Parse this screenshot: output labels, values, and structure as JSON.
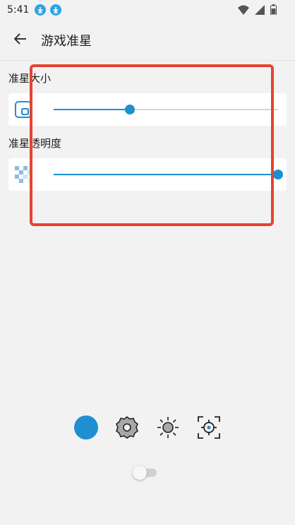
{
  "status_bar": {
    "time": "5:41",
    "icons": [
      "download-icon",
      "download-icon",
      "wifi-icon",
      "signal-icon",
      "battery-icon"
    ]
  },
  "app_bar": {
    "back_icon": "arrow-left-icon",
    "title": "游戏准星"
  },
  "settings": {
    "size": {
      "label": "准星大小",
      "icon": "crosshair-size-icon",
      "value_fraction": 0.34
    },
    "opacity": {
      "label": "准星透明度",
      "icon": "checkerboard-icon",
      "value_fraction": 1.0
    }
  },
  "toolbar": {
    "items": [
      "color-dot-icon",
      "settings-gear-icon",
      "brightness-icon",
      "crosshair-target-icon"
    ],
    "accent": "#1d8fd2"
  },
  "toggle": {
    "on": false
  },
  "highlight_color": "#e4442f"
}
